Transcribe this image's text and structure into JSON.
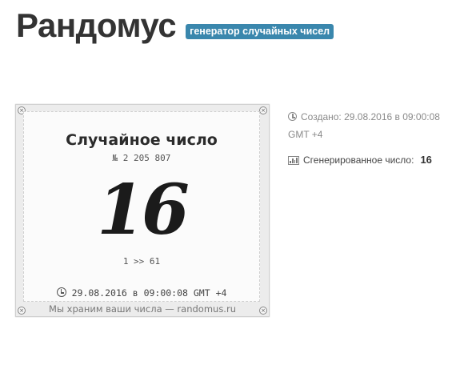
{
  "header": {
    "site_title": "Рандомус",
    "tagline": "генератор случайных чисел"
  },
  "card": {
    "title": "Случайное число",
    "number_label": "№  2 205 807",
    "value": "16",
    "range": "1 >> 61",
    "date": "29.08.2016 в 09:00:08 GMT +4",
    "footer": "Мы храним ваши числа — randomus.ru",
    "corner_glyph": "×"
  },
  "info": {
    "created_label": "Создано:",
    "created_value": "29.08.2016 в 09:00:08 GMT +4",
    "generated_label": "Сгенерированное число:",
    "generated_value": "16"
  },
  "icons": {
    "clock": "clock-icon",
    "chart": "bar-chart-icon"
  },
  "colors": {
    "tagline_bg": "#3a87ad",
    "title": "#333333"
  }
}
